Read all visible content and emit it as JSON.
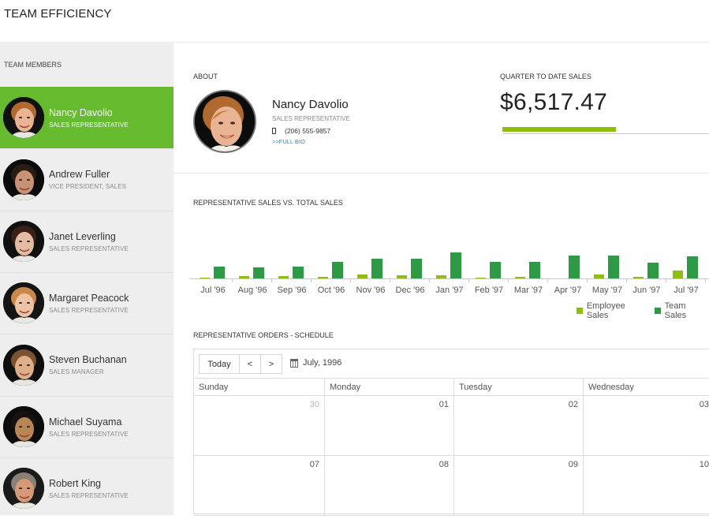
{
  "app": {
    "title": "TEAM EFFICIENCY"
  },
  "sidebar": {
    "heading": "TEAM MEMBERS",
    "members": [
      {
        "name": "Nancy Davolio",
        "role": "SALES REPRESENTATIVE",
        "selected": true
      },
      {
        "name": "Andrew Fuller",
        "role": "VICE PRESIDENT, SALES",
        "selected": false
      },
      {
        "name": "Janet Leverling",
        "role": "SALES REPRESENTATIVE",
        "selected": false
      },
      {
        "name": "Margaret Peacock",
        "role": "SALES REPRESENTATIVE",
        "selected": false
      },
      {
        "name": "Steven Buchanan",
        "role": "SALES MANAGER",
        "selected": false
      },
      {
        "name": "Michael Suyama",
        "role": "SALES REPRESENTATIVE",
        "selected": false
      },
      {
        "name": "Robert King",
        "role": "SALES REPRESENTATIVE",
        "selected": false
      }
    ]
  },
  "about": {
    "label": "ABOUT",
    "name": "Nancy Davolio",
    "role": "SALES REPRESENTATIVE",
    "phone": "(206) 555-9857",
    "bio_link": ">>FULL BIO",
    "phone_icon": "mobile-phone-icon"
  },
  "quarter_sales": {
    "label": "QUARTER TO DATE SALES",
    "value": "$6,517.47",
    "progress_fraction": 0.55,
    "progress_color": "#8ebe10"
  },
  "colors": {
    "accent": "#66bb2f",
    "employee_sales": "#8ebe10",
    "team_sales": "#2e9a45",
    "link": "#2e86c9"
  },
  "chart_data": {
    "type": "bar",
    "title": "REPRESENTATIVE SALES VS. TOTAL SALES",
    "xlabel": "",
    "ylabel": "",
    "categories": [
      "Jul '96",
      "Aug '96",
      "Sep '96",
      "Oct '96",
      "Nov '96",
      "Dec '96",
      "Jan '97",
      "Feb '97",
      "Mar '97",
      "Apr '97",
      "May '97",
      "Jun '97",
      "Jul '97"
    ],
    "series": [
      {
        "name": "Employee Sales",
        "color": "#8ebe10",
        "values": [
          1,
          3,
          3,
          2,
          5,
          4,
          4,
          1,
          2,
          0,
          5,
          2,
          10
        ]
      },
      {
        "name": "Team Sales",
        "color": "#2e9a45",
        "values": [
          15,
          14,
          15,
          21,
          25,
          25,
          33,
          21,
          21,
          29,
          29,
          20,
          28
        ]
      }
    ],
    "ylim": [
      0,
      40
    ],
    "y_units": "relative (no axis shown)",
    "grid": false,
    "legend": "bottom-right"
  },
  "schedule": {
    "label": "REPRESENTATIVE ORDERS - SCHEDULE",
    "today_label": "Today",
    "prev_label": "<",
    "next_label": ">",
    "date_range": "July, 1996",
    "calendar_icon": "calendar-icon",
    "days": [
      "Sunday",
      "Monday",
      "Tuesday",
      "Wednesday"
    ],
    "weeks": [
      [
        {
          "d": "30",
          "other": true
        },
        {
          "d": "01"
        },
        {
          "d": "02"
        },
        {
          "d": "03"
        }
      ],
      [
        {
          "d": "07"
        },
        {
          "d": "08"
        },
        {
          "d": "09"
        },
        {
          "d": "10"
        }
      ]
    ]
  }
}
